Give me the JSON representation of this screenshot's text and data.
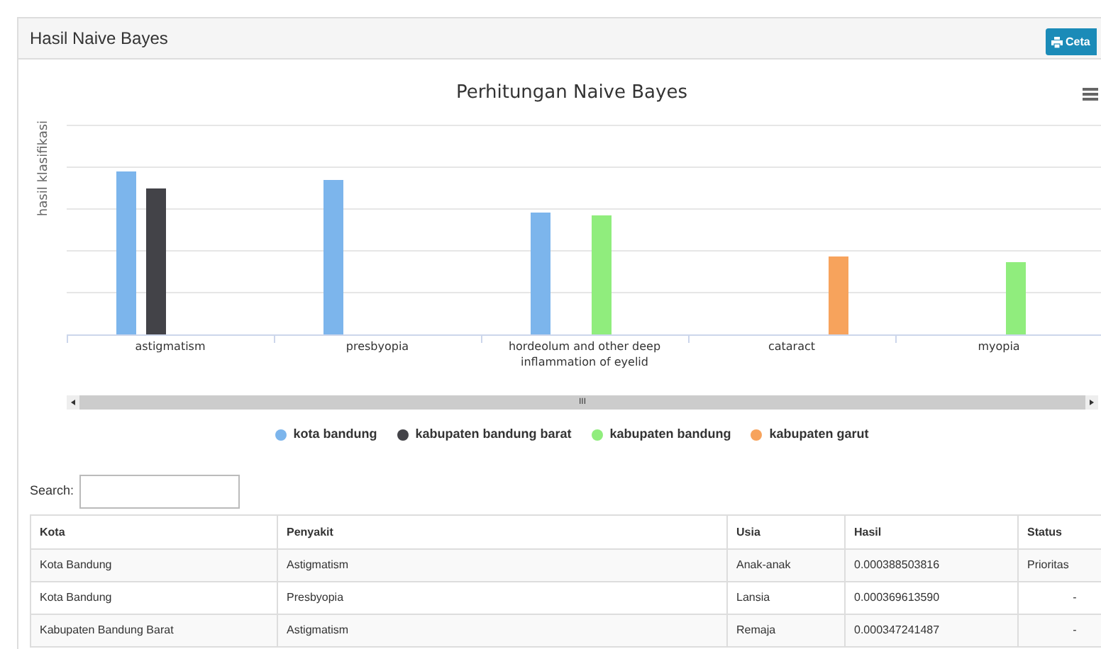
{
  "panel": {
    "title": "Hasil Naive Bayes",
    "print_button": "Ceta"
  },
  "chart": {
    "title": "Perhitungan Naive Bayes",
    "ylabel": "hasil klasifikasi",
    "categories": [
      "astigmatism",
      "presbyopia",
      "hordeolum and other deep inflammation of eyelid",
      "cataract",
      "myopia"
    ],
    "series": [
      {
        "name": "kota bandung",
        "color": "#7cb5ec"
      },
      {
        "name": "kabupaten bandung barat",
        "color": "#434348"
      },
      {
        "name": "kabupaten bandung",
        "color": "#90ed7d"
      },
      {
        "name": "kabupaten garut",
        "color": "#f7a35c"
      }
    ],
    "scrollbar_grip": "III"
  },
  "search": {
    "label": "Search:"
  },
  "table": {
    "columns": [
      "Kota",
      "Penyakit",
      "Usia",
      "Hasil",
      "Status"
    ],
    "rows": [
      [
        "Kota Bandung",
        "Astigmatism",
        "Anak-anak",
        "0.000388503816",
        "Prioritas"
      ],
      [
        "Kota Bandung",
        "Presbyopia",
        "Lansia",
        "0.000369613590",
        "-"
      ],
      [
        "Kabupaten Bandung Barat",
        "Astigmatism",
        "Remaja",
        "0.000347241487",
        "-"
      ]
    ]
  }
}
